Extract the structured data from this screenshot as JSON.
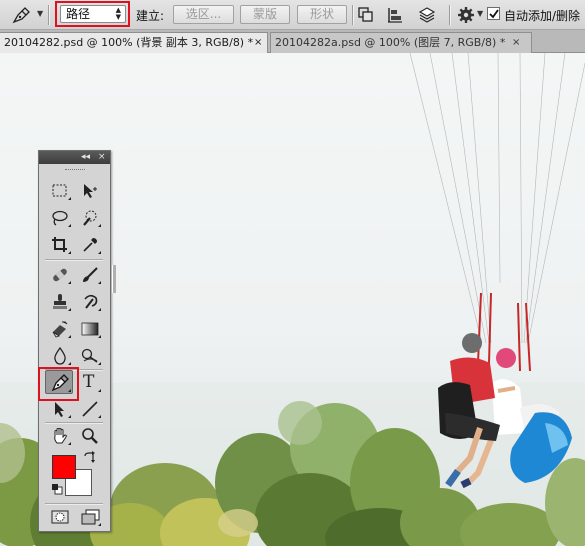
{
  "colors": {
    "highlight": "#e0101c",
    "foreground": "#ff0000",
    "background": "#ffffff"
  },
  "options_bar": {
    "tool_icon": "pen-tool-icon",
    "mode_select_value": "路径",
    "build_label": "建立:",
    "buttons": {
      "selection": "选区...",
      "mask": "蒙版",
      "shape": "形状"
    },
    "icons": [
      "path-operations-icon",
      "path-alignment-icon",
      "path-arrangement-icon",
      "gear-icon"
    ],
    "auto_add_checked": true,
    "auto_add_label": "自动添加/删除"
  },
  "tabs": [
    {
      "label": "20104282.psd @ 100% (背景 副本 3, RGB/8) *",
      "close": "×",
      "active": true
    },
    {
      "label": "20104282a.psd @ 100% (图层 7, RGB/8) *",
      "close": "×",
      "active": false
    }
  ],
  "tool_panel": {
    "header_collapse": "◂◂",
    "header_close": "×",
    "tools": [
      "rectangular-marquee-icon",
      "move-tool-icon",
      "lasso-tool-icon",
      "quick-selection-icon",
      "crop-tool-icon",
      "eyedropper-icon",
      "spot-healing-brush-icon",
      "brush-tool-icon",
      "clone-stamp-icon",
      "history-brush-icon",
      "eraser-tool-icon",
      "gradient-tool-icon",
      "blur-tool-icon",
      "dodge-tool-icon",
      "pen-tool-icon",
      "type-tool-icon",
      "path-selection-icon",
      "line-tool-icon",
      "hand-tool-icon",
      "zoom-tool-icon",
      "quick-mask-icon",
      "screen-mode-icon"
    ],
    "type_tool_glyph": "T",
    "selected_tool": "pen-tool-icon"
  }
}
